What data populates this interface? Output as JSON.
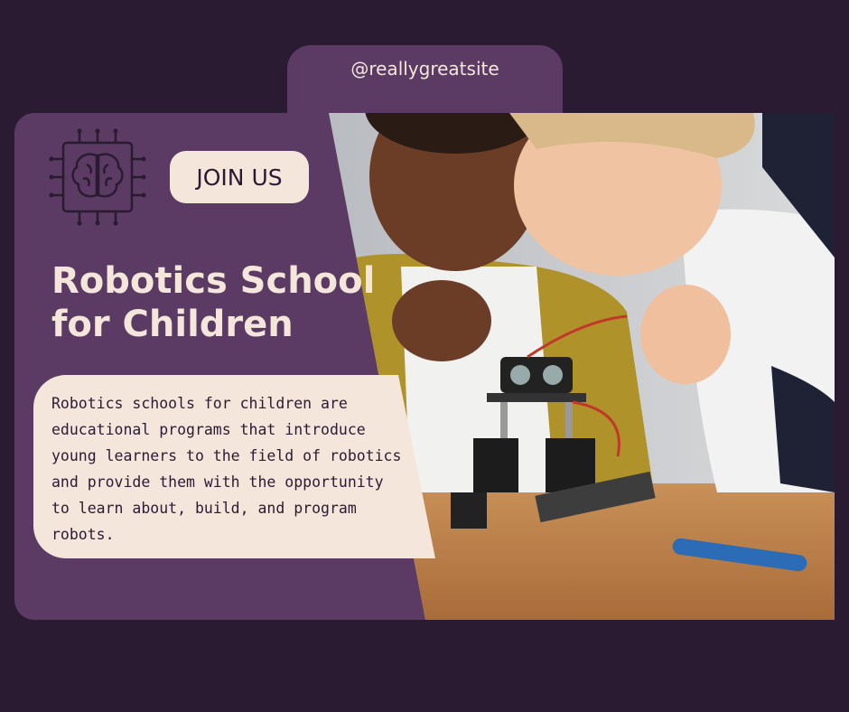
{
  "handle": "@reallygreatsite",
  "join_label": "JOIN US",
  "title_line1": "Robotics School",
  "title_line2": "for Children",
  "description": "Robotics schools for children are educational programs that introduce young learners to the field of robotics and provide them with the opportunity to learn about, build, and program robots.",
  "colors": {
    "background": "#2a1b33",
    "panel": "#5b3a63",
    "cream": "#f5e6dc",
    "text_dark": "#2a1b33"
  },
  "icons": [
    "brain-chip-icon"
  ]
}
